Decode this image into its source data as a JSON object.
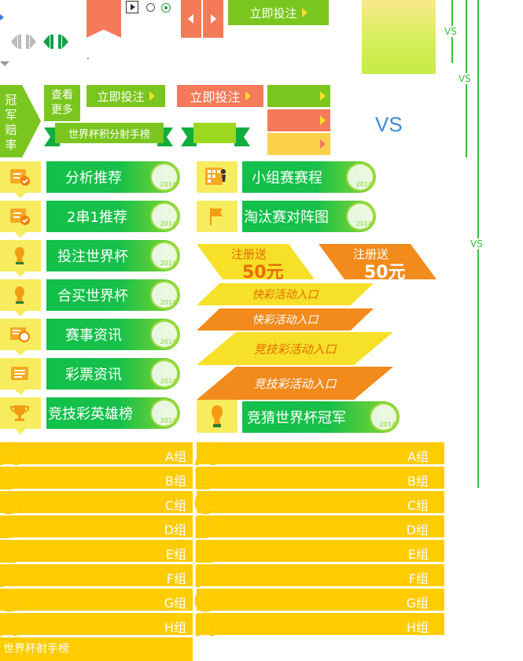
{
  "top": {
    "bet_now_1": "立即投注",
    "bet_now_2": "立即投注",
    "bet_now_3": "立即投注",
    "view_more_1": "查看",
    "view_more_2": "更多",
    "champion_odds": [
      "冠",
      "军",
      "赔",
      "率"
    ],
    "ranking_banner": "世界杯积分射手榜",
    "vs_big": "VS",
    "vs_small_1": "VS",
    "vs_small_2": "VS",
    "vs_small_3": "VS",
    "dot": "."
  },
  "left_nav": [
    {
      "label": "分析推荐",
      "icon": "checklist-icon"
    },
    {
      "label": "2串1推荐",
      "icon": "checklist-icon"
    },
    {
      "label": "投注世界杯",
      "icon": "trophy-icon"
    },
    {
      "label": "合买世界杯",
      "icon": "trophy-icon"
    },
    {
      "label": "赛事资讯",
      "icon": "news-ball-icon"
    },
    {
      "label": "彩票资讯",
      "icon": "news-icon"
    },
    {
      "label": "竞技彩英雄榜",
      "icon": "cup-icon"
    }
  ],
  "right_nav": [
    {
      "label": "小组赛赛程",
      "icon": "schedule-grid-icon"
    },
    {
      "label": "淘汰赛对阵图",
      "icon": "flag-icon"
    },
    {
      "label": "竞猜世界杯冠军",
      "icon": "trophy-icon"
    }
  ],
  "promos": {
    "register_1": "注册送",
    "amount_1": "50元",
    "register_2": "注册送",
    "amount_2": "50元",
    "kuaicai_1": "快彩活动入口",
    "kuaicai_2": "快彩活动入口",
    "jingji_1": "竞技彩活动入口",
    "jingji_2": "竞技彩活动入口"
  },
  "groups": [
    {
      "letter": "A",
      "name": "A组"
    },
    {
      "letter": "B",
      "name": "B组"
    },
    {
      "letter": "C",
      "name": "C组"
    },
    {
      "letter": "D",
      "name": "D组"
    },
    {
      "letter": "E",
      "name": "E组"
    },
    {
      "letter": "F",
      "name": "F组"
    },
    {
      "letter": "G",
      "name": "G组"
    },
    {
      "letter": "H",
      "name": "H组"
    }
  ],
  "footer": {
    "scorers": "世界杯射手榜"
  },
  "colors": {
    "green": "#7ac61f",
    "orange": "#f47a5a",
    "yellow": "#ffcc00",
    "light_yellow": "#f6ec5e"
  }
}
